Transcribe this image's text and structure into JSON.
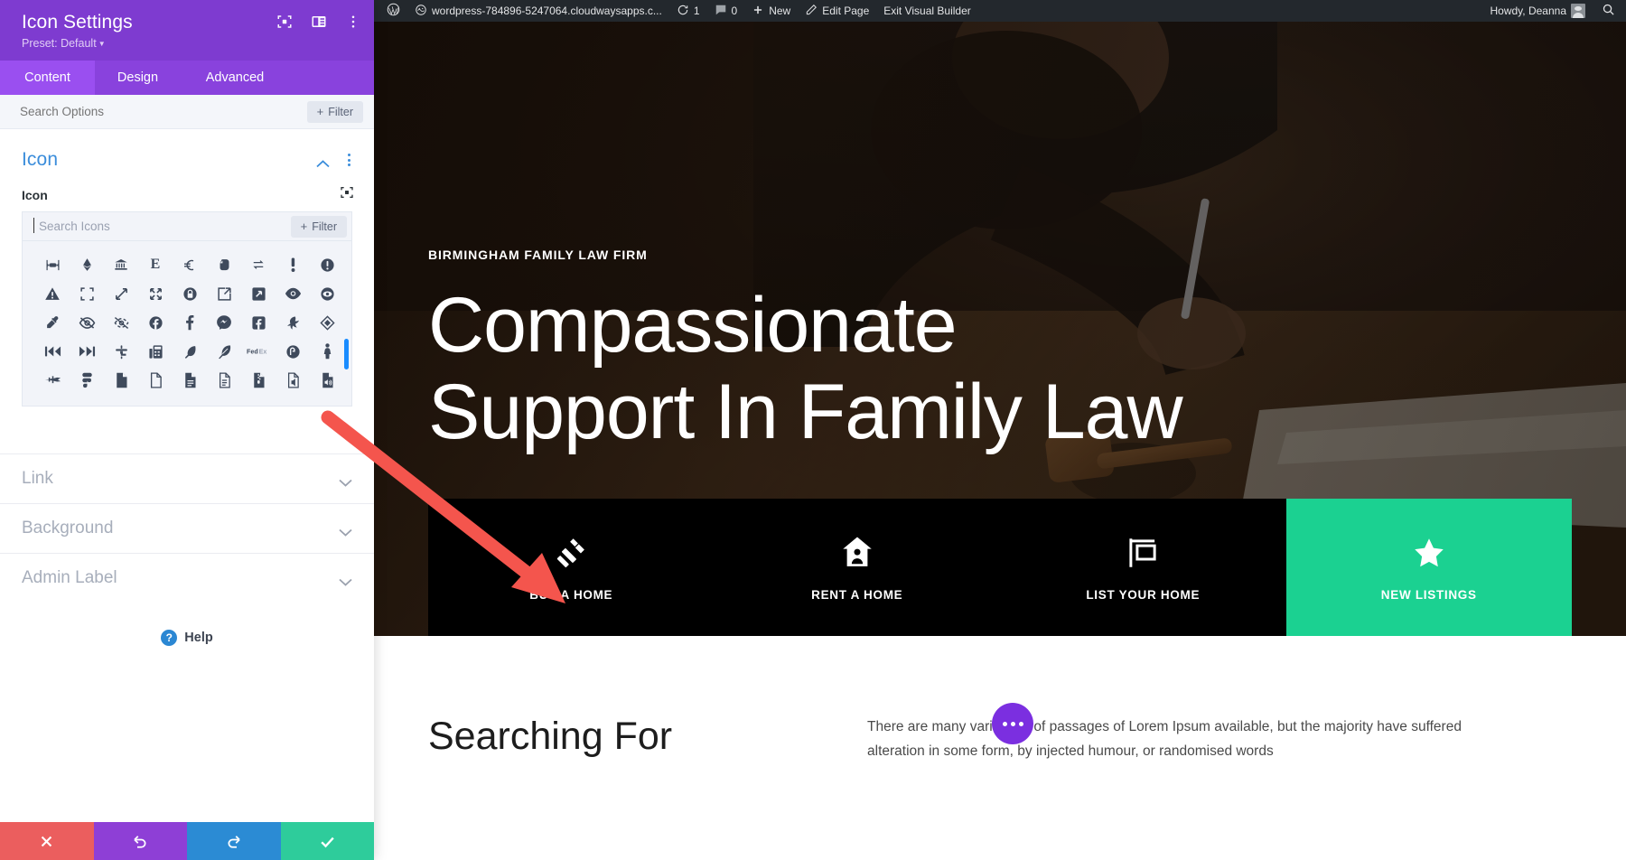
{
  "panel": {
    "title": "Icon Settings",
    "preset": "Preset: Default",
    "header_icons": [
      "target-icon",
      "layout-panel-icon",
      "kebab-menu-icon"
    ],
    "tabs": [
      {
        "label": "Content",
        "active": true
      },
      {
        "label": "Design",
        "active": false
      },
      {
        "label": "Advanced",
        "active": false
      }
    ],
    "search_options": {
      "placeholder": "Search Options",
      "value": "",
      "filter_label": "Filter"
    },
    "icon_section": {
      "heading": "Icon",
      "field_label": "Icon",
      "search": {
        "placeholder": "Search Icons",
        "value": "",
        "filter_label": "Filter"
      },
      "grid_icons": [
        "transgender-alt-icon",
        "ethereum-icon",
        "university-icon",
        "etsy-icon",
        "euro-icon",
        "evernote-icon",
        "exchange-icon",
        "exclamation-icon",
        "exclamation-circle-icon",
        "exclamation-triangle-icon",
        "expand-icon",
        "expand-arrows-icon",
        "expand-arrows-alt-icon",
        "lock-circle-icon",
        "external-link-icon",
        "external-link-square-icon",
        "eye-icon",
        "eye-slash-circle-icon",
        "eye-dropper-icon",
        "eye-slash-icon",
        "low-vision-icon",
        "facebook-circle-icon",
        "facebook-f-icon",
        "facebook-messenger-icon",
        "facebook-square-icon",
        "fast-backward-alt-icon",
        "fantasy-flight-games-icon",
        "fast-backward-icon",
        "fast-forward-icon",
        "faucet-icon",
        "fax-icon",
        "feather-icon",
        "feather-alt-icon",
        "fedex-icon",
        "fedora-icon",
        "female-icon",
        "fighter-jet-icon",
        "figma-icon",
        "file-icon",
        "file-alt-icon",
        "file-lines-icon",
        "file-text-icon",
        "file-archive-icon",
        "file-audio-icon",
        "file-volume-icon"
      ]
    },
    "accordions": [
      {
        "label": "Link"
      },
      {
        "label": "Background"
      },
      {
        "label": "Admin Label"
      }
    ],
    "help_label": "Help",
    "footer_buttons": [
      {
        "name": "cancel",
        "icon": "close-icon",
        "color": "#eb5e5e"
      },
      {
        "name": "undo",
        "icon": "undo-icon",
        "color": "#8e3fd6"
      },
      {
        "name": "redo",
        "icon": "redo-icon",
        "color": "#2b8bd4"
      },
      {
        "name": "save",
        "icon": "check-icon",
        "color": "#2ecc9b"
      }
    ]
  },
  "adminbar": {
    "site_title": "wordpress-784896-5247064.cloudwaysapps.c...",
    "updates_count": "1",
    "comments_count": "0",
    "new_label": "New",
    "edit_page_label": "Edit Page",
    "exit_label": "Exit Visual Builder",
    "howdy": "Howdy, Deanna"
  },
  "hero": {
    "eyebrow": "BIRMINGHAM FAMILY LAW FIRM",
    "heading_line1": "Compassionate",
    "heading_line2": "Support In Family Law"
  },
  "cta_bar": {
    "accent_color": "#1bd191",
    "items": [
      {
        "label": "BUY A HOME",
        "icon": "gavel-icon",
        "accent": false
      },
      {
        "label": "RENT A HOME",
        "icon": "house-person-icon",
        "accent": false
      },
      {
        "label": "LIST YOUR HOME",
        "icon": "sign-post-icon",
        "accent": false
      },
      {
        "label": "NEW LISTINGS",
        "icon": "star-icon",
        "accent": true
      }
    ]
  },
  "content": {
    "heading": "Searching For",
    "paragraph": "There are many variations of passages of Lorem Ipsum available, but the majority have suffered alteration in some form, by injected humour, or randomised words"
  },
  "annotation": {
    "arrow_color": "#f4554d"
  }
}
